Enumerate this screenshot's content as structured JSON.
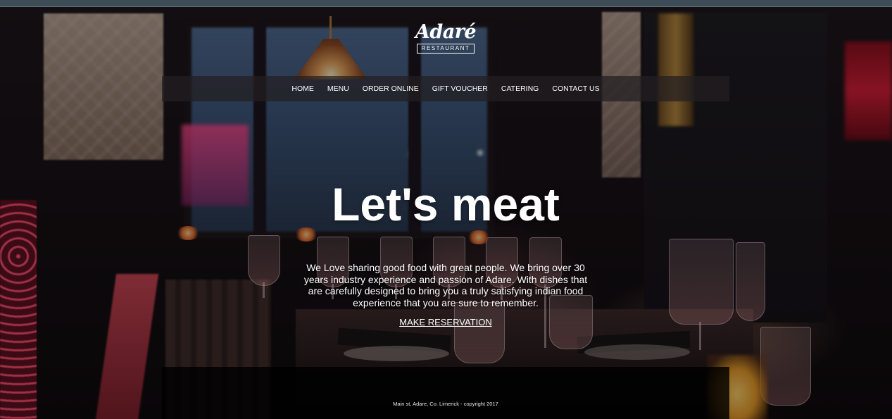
{
  "logo": {
    "name": "Adaré",
    "subtitle": "RESTAURANT"
  },
  "nav": {
    "items": [
      {
        "label": "HOME"
      },
      {
        "label": "MENU"
      },
      {
        "label": "ORDER ONLINE"
      },
      {
        "label": "GIFT VOUCHER"
      },
      {
        "label": "CATERING"
      },
      {
        "label": "CONTACT US"
      }
    ]
  },
  "hero": {
    "title": "Let's meat",
    "description": "We Love sharing good food with great people. We bring over 30 years industry experience and passion of Adare. With dishes that are carefully designed to bring you a truly satisfying indian food experience that you are sure to remember.",
    "cta_label": "MAKE RESERVATION"
  },
  "footer": {
    "text": "Main st, Adare, Co. Limerick - copyright 2017"
  },
  "colors": {
    "text": "#ffffff",
    "nav_bg": "rgba(35,30,33,0.72)",
    "footer_bg": "rgba(0,0,0,0.82)",
    "top_strip": "#3d4c57"
  }
}
